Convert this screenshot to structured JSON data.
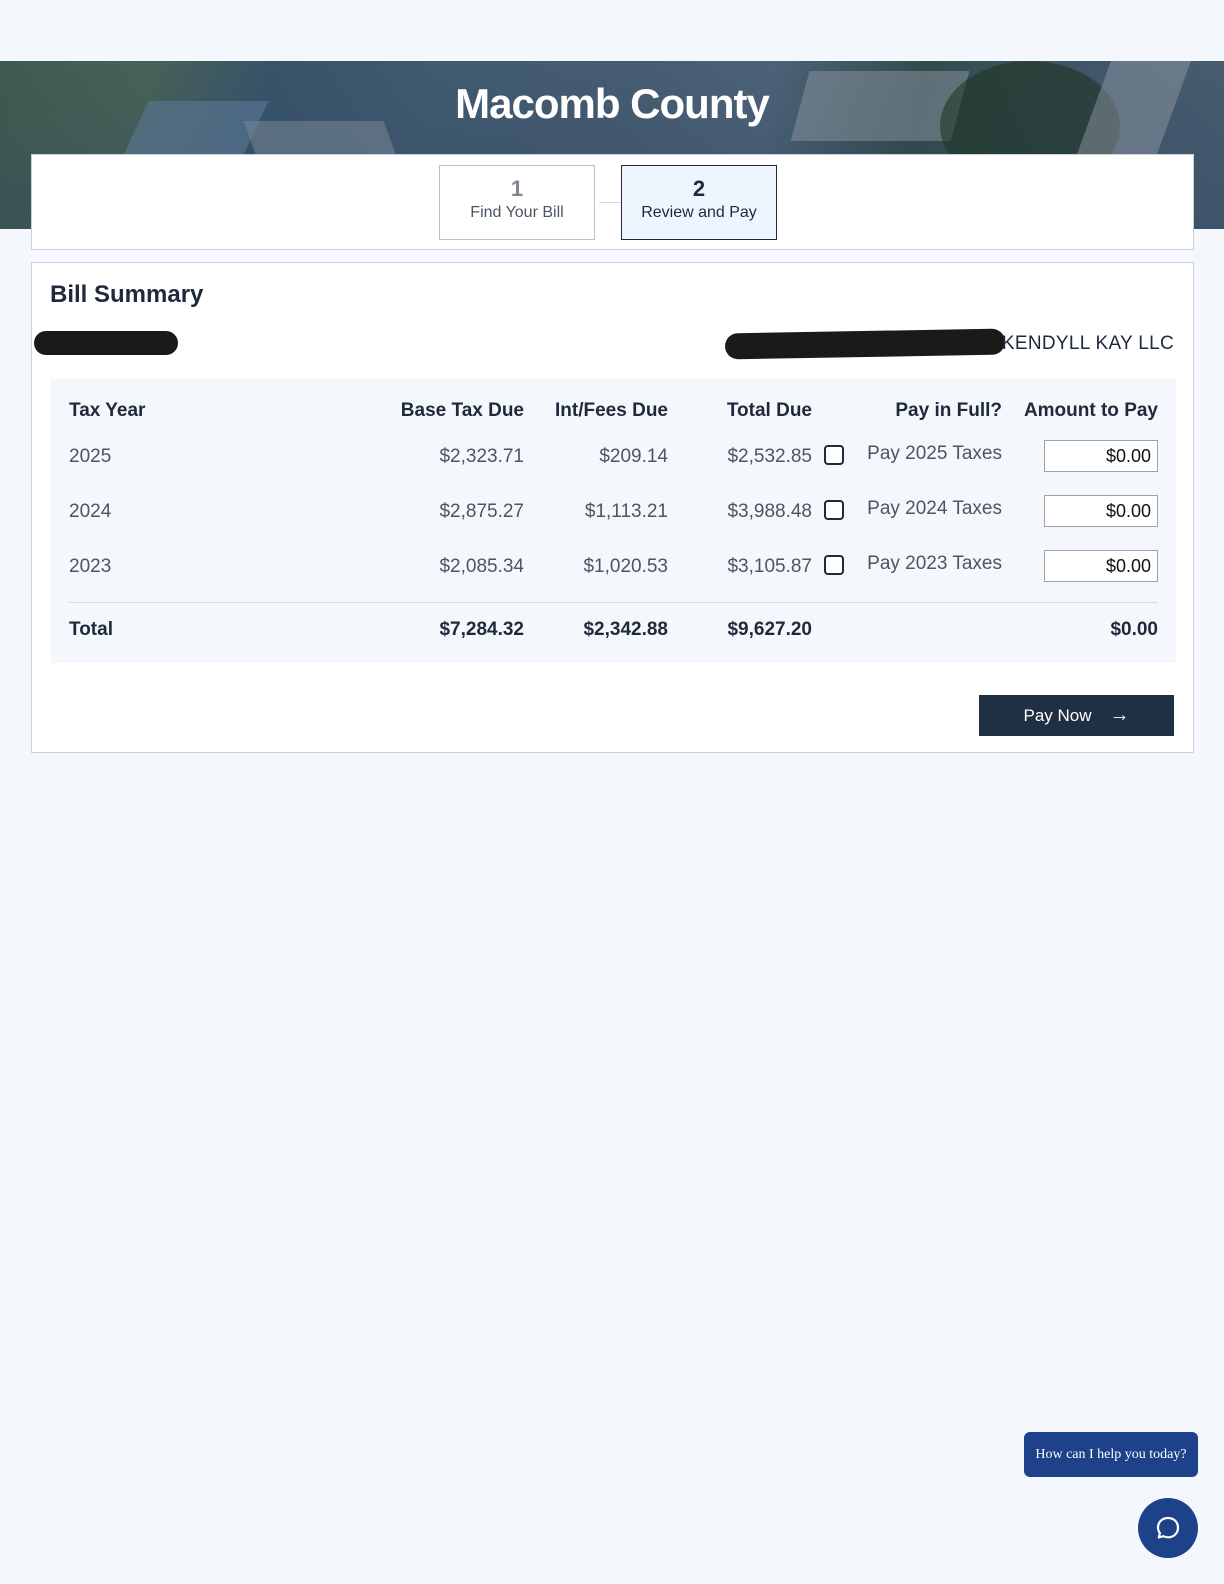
{
  "header": {
    "title": "Macomb County"
  },
  "steps": [
    {
      "number": "1",
      "label": "Find Your Bill",
      "active": false
    },
    {
      "number": "2",
      "label": "Review and Pay",
      "active": true
    }
  ],
  "summary": {
    "title": "Bill Summary",
    "owner": "KENDYLL KAY LLC",
    "columns": [
      "Tax Year",
      "Base Tax Due",
      "Int/Fees Due",
      "Total Due",
      "Pay in Full?",
      "Amount to Pay"
    ],
    "rows": [
      {
        "year": "2025",
        "base": "$2,323.71",
        "fees": "$209.14",
        "total": "$2,532.85",
        "pay_label": "Pay 2025 Taxes",
        "amount": "$0.00"
      },
      {
        "year": "2024",
        "base": "$2,875.27",
        "fees": "$1,113.21",
        "total": "$3,988.48",
        "pay_label": "Pay 2024 Taxes",
        "amount": "$0.00"
      },
      {
        "year": "2023",
        "base": "$2,085.34",
        "fees": "$1,020.53",
        "total": "$3,105.87",
        "pay_label": "Pay 2023 Taxes",
        "amount": "$0.00"
      }
    ],
    "totals": {
      "label": "Total",
      "base": "$7,284.32",
      "fees": "$2,342.88",
      "total": "$9,627.20",
      "amount": "$0.00"
    },
    "pay_button": "Pay Now"
  },
  "chat": {
    "prompt": "How can I help you today?"
  }
}
